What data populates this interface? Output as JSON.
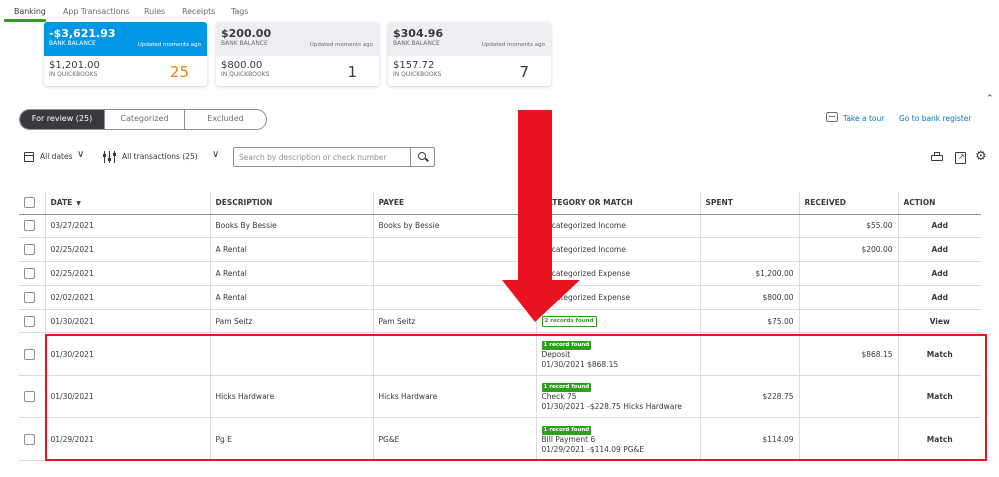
{
  "tabs": [
    "Banking",
    "App Transactions",
    "Rules",
    "Receipts",
    "Tags"
  ],
  "cards": [
    {
      "bank_amount": "-$3,621.93",
      "bank_label": "BANK BALANCE",
      "updated": "Updated moments ago",
      "qb_amount": "$1,201.00",
      "qb_label": "IN QUICKBOOKS",
      "count": "25"
    },
    {
      "bank_amount": "$200.00",
      "bank_label": "BANK BALANCE",
      "updated": "Updated moments ago",
      "qb_amount": "$800.00",
      "qb_label": "IN QUICKBOOKS",
      "count": "1"
    },
    {
      "bank_amount": "$304.96",
      "bank_label": "BANK BALANCE",
      "updated": "Updated moments ago",
      "qb_amount": "$157.72",
      "qb_label": "IN QUICKBOOKS",
      "count": "7"
    }
  ],
  "segments": [
    "For review (25)",
    "Categorized",
    "Excluded"
  ],
  "links": {
    "tour": "Take a tour",
    "register": "Go to bank register"
  },
  "filters": {
    "dates": "All dates",
    "transactions": "All transactions (25)",
    "search_placeholder": "Search by description or check number"
  },
  "columns": {
    "date": "DATE",
    "description": "DESCRIPTION",
    "payee": "PAYEE",
    "category": "CATEGORY OR MATCH",
    "spent": "SPENT",
    "received": "RECEIVED",
    "action": "ACTION"
  },
  "rows": [
    {
      "date": "03/27/2021",
      "description": "Books By Bessie",
      "payee": "Books by Bessie",
      "category": "Uncategorized Income",
      "spent": "",
      "received": "$55.00",
      "action": "Add"
    },
    {
      "date": "02/25/2021",
      "description": "A Rental",
      "payee": "",
      "category": "Uncategorized Income",
      "spent": "",
      "received": "$200.00",
      "action": "Add"
    },
    {
      "date": "02/25/2021",
      "description": "A Rental",
      "payee": "",
      "category": "Uncategorized Expense",
      "spent": "$1,200.00",
      "received": "",
      "action": "Add"
    },
    {
      "date": "02/02/2021",
      "description": "A Rental",
      "payee": "",
      "category": "Uncategorized Expense",
      "spent": "$800.00",
      "received": "",
      "action": "Add"
    },
    {
      "date": "01/30/2021",
      "description": "Pam Seitz",
      "payee": "Pam Seitz",
      "badge": "2 records found",
      "spent": "$75.00",
      "received": "",
      "action": "View"
    }
  ],
  "match_rows": [
    {
      "date": "01/30/2021",
      "description": "",
      "payee": "",
      "badge": "1 record found",
      "line1": "Deposit",
      "line2": "01/30/2021 $868.15",
      "spent": "",
      "received": "$868.15",
      "action": "Match"
    },
    {
      "date": "01/30/2021",
      "description": "Hicks Hardware",
      "payee": "Hicks Hardware",
      "badge": "1 record found",
      "line1": "Check 75",
      "line2": "01/30/2021 -$228.75 Hicks Hardware",
      "spent": "$228.75",
      "received": "",
      "action": "Match"
    },
    {
      "date": "01/29/2021",
      "description": "Pg E",
      "payee": "PG&E",
      "badge": "1 record found",
      "line1": "Bill Payment 6",
      "line2": "01/29/2021 -$114.09 PG&E",
      "spent": "$114.09",
      "received": "",
      "action": "Match"
    }
  ],
  "colors": {
    "accent_blue": "#0097e6",
    "link_blue": "#0077c5",
    "green": "#2ca01c",
    "annotation_red": "#e8131e",
    "count_orange": "#ff8000"
  }
}
